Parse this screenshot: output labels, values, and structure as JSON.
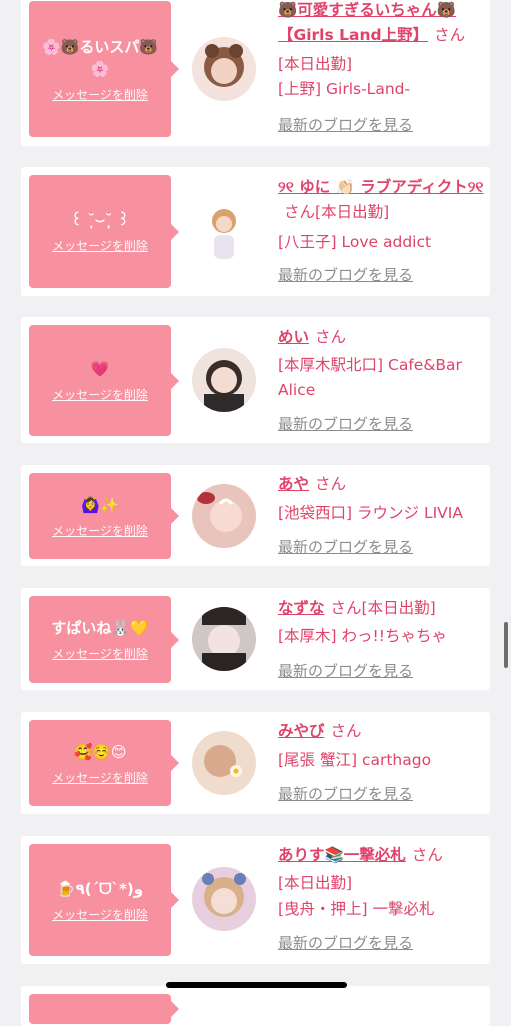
{
  "rows": [
    {
      "message": "🌸🐻るいスパ🐻🌸",
      "delete_label": "メッセージを削除",
      "name": "🐻可愛すぎるいちゃん🐻【Girls Land上野】",
      "san": "さん",
      "line1": "[本日出勤]",
      "line2": "[上野] Girls-Land-",
      "blog": "最新のブログを見る",
      "avatar_color": "#c89a8a"
    },
    {
      "message": "꒰ ˘̩̩̩⌣˘̩̩̩ ꒱",
      "delete_label": "メッセージを削除",
      "name": "୨୧ ゆに 👏🏻 ラブアディクト୨୧",
      "san": "さん",
      "line1": "[本日出勤]",
      "line2": "[八王子] Love addict",
      "blog": "最新のブログを見る",
      "avatar_color": "#e6cdbd"
    },
    {
      "message": "💗",
      "delete_label": "メッセージを削除",
      "name": "めい",
      "san": "さん",
      "line1": "[本厚木駅北口] Cafe&Bar",
      "line2": "Alice",
      "blog": "最新のブログを見る",
      "avatar_color": "#d8b5ad"
    },
    {
      "message": "🙆‍♀️✨",
      "delete_label": "メッセージを削除",
      "name": "あや",
      "san": "さん",
      "line1": "[池袋西口] ラウンジ LIVIA",
      "line2": "",
      "blog": "最新のブログを見る",
      "avatar_color": "#cf8c82"
    },
    {
      "message": "すぱいね🐰💛",
      "delete_label": "メッセージを削除",
      "name": "なずな",
      "san": "さん",
      "line1": "[本日出勤]",
      "line2": "[本厚木] わっ!!ちゃちゃ",
      "blog": "最新のブログを見る",
      "avatar_color": "#7a6c69"
    },
    {
      "message": "🥰☺️😊",
      "delete_label": "メッセージを削除",
      "name": "みやび",
      "san": "さん",
      "line1": "[尾張 蟹江] carthago",
      "line2": "",
      "blog": "最新のブログを見る",
      "avatar_color": "#e2c1a9"
    },
    {
      "message": "🍺٩(ˊᗜˋ*)و",
      "delete_label": "メッセージを削除",
      "name": "ありす📚一撃必札",
      "san": "さん",
      "line1": "[本日出勤]",
      "line2": "[曳舟・押上] 一撃必札",
      "blog": "最新のブログを見る",
      "avatar_color": "#c79baa"
    }
  ]
}
